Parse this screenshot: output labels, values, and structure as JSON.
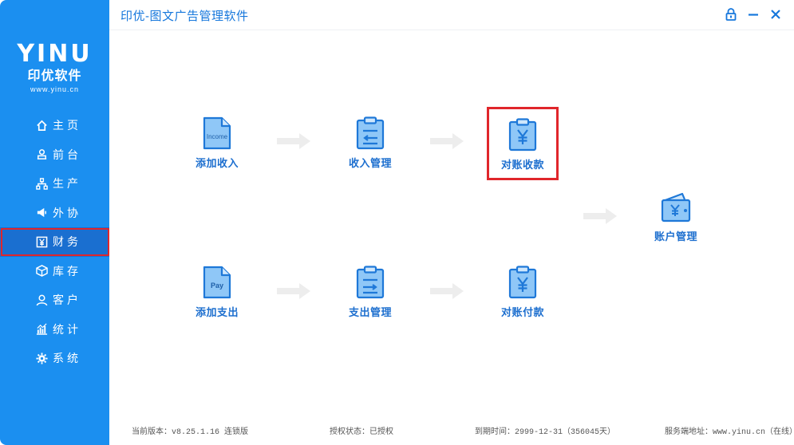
{
  "app": {
    "title": "印优-图文广告管理软件"
  },
  "logo": {
    "mark": "YINU",
    "name": "印优软件",
    "url": "www.yinu.cn"
  },
  "sidebar": {
    "items": [
      {
        "label": "主页",
        "icon": "home-icon"
      },
      {
        "label": "前台",
        "icon": "user-desk-icon"
      },
      {
        "label": "生产",
        "icon": "hierarchy-icon"
      },
      {
        "label": "外协",
        "icon": "megaphone-icon"
      },
      {
        "label": "财务",
        "icon": "yen-icon",
        "active": true
      },
      {
        "label": "库存",
        "icon": "box-icon"
      },
      {
        "label": "客户",
        "icon": "person-icon"
      },
      {
        "label": "统计",
        "icon": "chart-icon"
      },
      {
        "label": "系统",
        "icon": "gear-icon"
      }
    ]
  },
  "flow": {
    "add_income": {
      "label": "添加收入",
      "doc_text": "Income"
    },
    "income_mgmt": {
      "label": "收入管理"
    },
    "reconcile_receipt": {
      "label": "对账收款"
    },
    "account_mgmt": {
      "label": "账户管理"
    },
    "add_expense": {
      "label": "添加支出",
      "doc_text": "Pay"
    },
    "expense_mgmt": {
      "label": "支出管理"
    },
    "reconcile_payment": {
      "label": "对账付款"
    }
  },
  "footer": {
    "version": "当前版本：v8.25.1.16  连锁版",
    "license": "授权状态：已授权",
    "expiry": "到期时间：2999-12-31（356045天）",
    "server": "服务端地址：www.yinu.cn（在线）"
  },
  "colors": {
    "sidebar": "#1b8ff0",
    "active": "#1a6fd0",
    "accent": "#1677dc",
    "icon_fill": "#8fc7f7",
    "icon_stroke": "#1e78d8",
    "highlight": "#e0262b"
  }
}
